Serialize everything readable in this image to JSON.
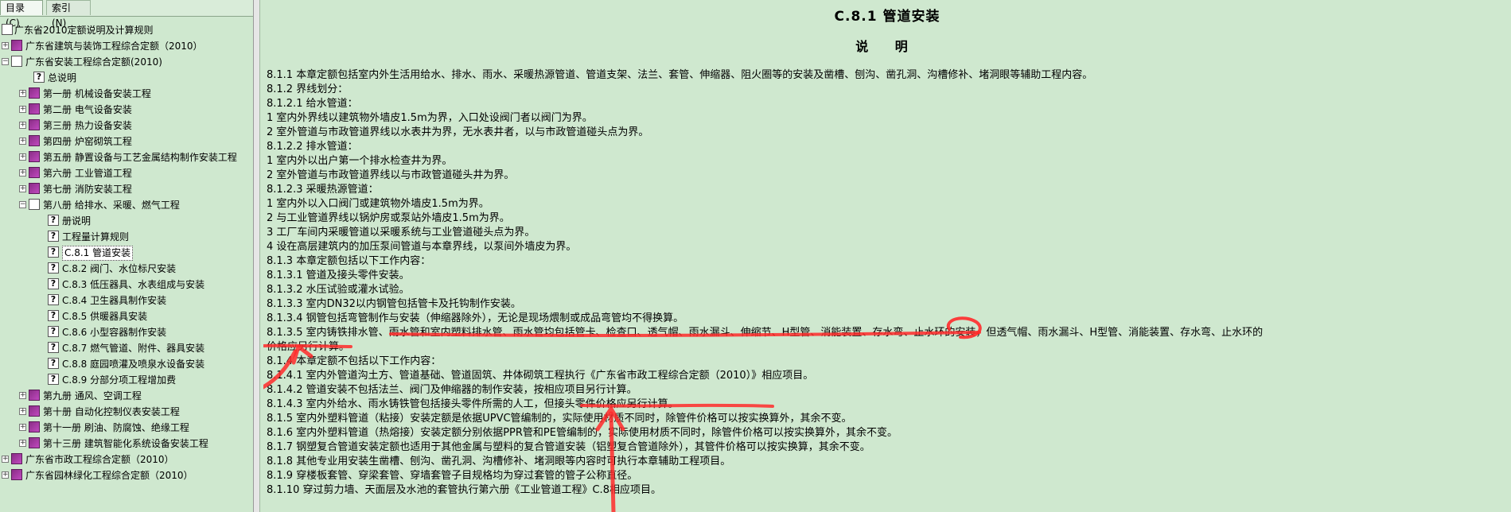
{
  "tabs": [
    {
      "label": "目录(C)"
    },
    {
      "label": "索引(N)"
    }
  ],
  "tree": [
    {
      "label": "广东省2010定额说明及计算规则"
    },
    {
      "label": "广东省建筑与装饰工程综合定额（2010）"
    },
    {
      "label": "广东省安装工程综合定额(2010)"
    },
    {
      "label": "总说明"
    },
    {
      "label": "第一册 机械设备安装工程"
    },
    {
      "label": "第二册 电气设备安装"
    },
    {
      "label": "第三册 热力设备安装"
    },
    {
      "label": "第四册 炉窑砌筑工程"
    },
    {
      "label": "第五册 静置设备与工艺金属结构制作安装工程"
    },
    {
      "label": "第六册 工业管道工程"
    },
    {
      "label": "第七册 消防安装工程"
    },
    {
      "label": "第八册 给排水、采暖、燃气工程"
    },
    {
      "label": "册说明"
    },
    {
      "label": "工程量计算规则"
    },
    {
      "label": "C.8.1  管道安装"
    },
    {
      "label": "C.8.2  阀门、水位标尺安装"
    },
    {
      "label": "C.8.3  低压器具、水表组成与安装"
    },
    {
      "label": "C.8.4  卫生器具制作安装"
    },
    {
      "label": "C.8.5  供暖器具安装"
    },
    {
      "label": "C.8.6  小型容器制作安装"
    },
    {
      "label": "C.8.7  燃气管道、附件、器具安装"
    },
    {
      "label": "C.8.8  庭园喷灌及喷泉水设备安装"
    },
    {
      "label": "C.8.9  分部分项工程增加费"
    },
    {
      "label": "第九册 通风、空调工程"
    },
    {
      "label": "第十册 自动化控制仪表安装工程"
    },
    {
      "label": "第十一册 刷油、防腐蚀、绝缘工程"
    },
    {
      "label": "第十三册 建筑智能化系统设备安装工程"
    },
    {
      "label": "广东省市政工程综合定额（2010）"
    },
    {
      "label": "广东省园林绿化工程综合定额（2010）"
    }
  ],
  "content": {
    "title": "C.8.1   管道安装",
    "subtitle": "说  明",
    "lines": [
      "8.1.1  本章定额包括室内外生活用给水、排水、雨水、采暖热源管道、管道支架、法兰、套管、伸缩器、阻火圈等的安装及凿槽、刨沟、凿孔洞、沟槽修补、堵洞眼等辅助工程内容。",
      "8.1.2  界线划分：",
      "8.1.2.1  给水管道：",
      "    1  室内外界线以建筑物外墙皮1.5m为界，入口处设阀门者以阀门为界。",
      "    2  室外管道与市政管道界线以水表井为界，无水表井者，以与市政管道碰头点为界。",
      "8.1.2.2  排水管道：",
      "    1  室内外以出户第一个排水检查井为界。",
      "    2  室外管道与市政管道界线以与市政管道碰头井为界。",
      "8.1.2.3  采暖热源管道：",
      "    1  室内外以入口阀门或建筑物外墙皮1.5m为界。",
      "    2  与工业管道界线以锅炉房或泵站外墙皮1.5m为界。",
      "    3  工厂车间内采暖管道以采暖系统与工业管道碰头点为界。",
      "    4  设在高层建筑内的加压泵间管道与本章界线，以泵间外墙皮为界。",
      "8.1.3  本章定额包括以下工作内容：",
      "8.1.3.1  管道及接头零件安装。",
      "8.1.3.2  水压试验或灌水试验。",
      "8.1.3.3  室内DN32以内钢管包括管卡及托钩制作安装。",
      "8.1.3.4  钢管包括弯管制作与安装（伸缩器除外），无论是现场煨制或成品弯管均不得换算。",
      "8.1.3.5  室内铸铁排水管、雨水管和室内塑料排水管、雨水管均包括管卡、检查口、透气帽、雨水漏斗、伸缩节、H型管、消能装置、存水弯、止水环的安装，但透气帽、雨水漏斗、H型管、消能装置、存水弯、止水环的",
      "价格应另行计算。",
      "8.1.4  本章定额不包括以下工作内容：",
      "8.1.4.1  室内外管道沟土方、管道基础、管道固筑、井体砌筑工程执行《广东省市政工程综合定额（2010）》相应项目。",
      "8.1.4.2  管道安装不包括法兰、阀门及伸缩器的制作安装，按相应项目另行计算。",
      "8.1.4.3  室内外给水、雨水铸铁管包括接头零件所需的人工，但接头零件价格应另行计算。",
      "8.1.5  室内外塑料管道（粘接）安装定额是依据UPVC管编制的，实际使用材质不同时，除管件价格可以按实换算外，其余不变。",
      "8.1.6  室内外塑料管道（热熔接）安装定额分别依据PPR管和PE管编制的，实际使用材质不同时，除管件价格可以按实换算外，其余不变。",
      "8.1.7  钢塑复合管道安装定额也适用于其他金属与塑料的复合管道安装（铝塑复合管道除外），其管件价格可以按实换算，其余不变。",
      "8.1.8  其他专业用安装生凿槽、刨沟、凿孔洞、沟槽修补、堵洞眼等内容时可执行本章辅助工程项目。",
      "8.1.9  穿楼板套管、穿梁套管、穿墙套管子目规格均为穿过套管的管子公称直径。",
      "8.1.10   穿过剪力墙、天面层及水池的套管执行第六册《工业管道工程》C.8相应项目。"
    ]
  },
  "colors": {
    "background": "#cfe8cf",
    "annotation": "#ff2a2a"
  },
  "icons": {
    "book": "book-icon",
    "open": "open-book-icon",
    "help": "help-page-icon",
    "expand": "expand-icon",
    "collapse": "collapse-icon"
  }
}
